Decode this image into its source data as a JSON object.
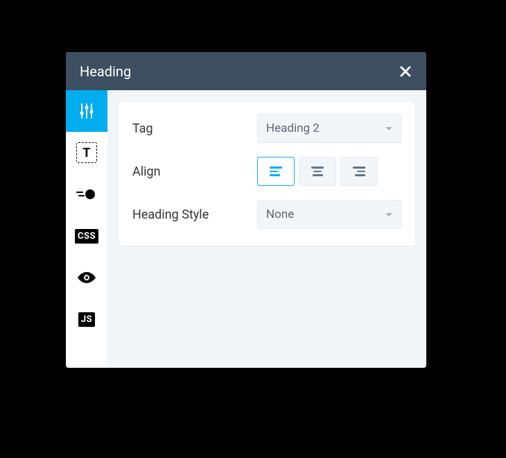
{
  "header": {
    "title": "Heading"
  },
  "sidebar": {
    "items": [
      {
        "name": "settings"
      },
      {
        "name": "text"
      },
      {
        "name": "animation"
      },
      {
        "name": "css",
        "label": "CSS"
      },
      {
        "name": "visibility"
      },
      {
        "name": "js",
        "label": "JS"
      }
    ],
    "active_index": 0
  },
  "fields": {
    "tag": {
      "label": "Tag",
      "value": "Heading 2"
    },
    "align": {
      "label": "Align",
      "options": [
        "left",
        "center",
        "right"
      ],
      "selected": "left"
    },
    "heading_style": {
      "label": "Heading Style",
      "value": "None"
    }
  }
}
